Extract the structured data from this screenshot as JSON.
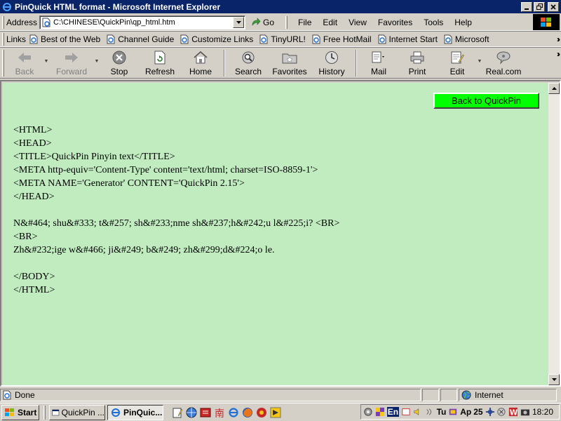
{
  "window": {
    "title": "PinQuick HTML format - Microsoft Internet Explorer",
    "buttons": [
      "minimize-button",
      "restore-button",
      "close-button"
    ]
  },
  "address_bar": {
    "label": "Address",
    "value": "C:\\CHINESE\\QuickPin\\qp_html.htm",
    "go_label": "Go"
  },
  "menu": {
    "items": [
      "File",
      "Edit",
      "View",
      "Favorites",
      "Tools",
      "Help"
    ]
  },
  "links_bar": {
    "label": "Links",
    "items": [
      "Best of the Web",
      "Channel Guide",
      "Customize Links",
      "TinyURL!",
      "Free HotMail",
      "Internet Start",
      "Microsoft"
    ]
  },
  "toolbar": {
    "back": "Back",
    "forward": "Forward",
    "stop": "Stop",
    "refresh": "Refresh",
    "home": "Home",
    "search": "Search",
    "favorites": "Favorites",
    "history": "History",
    "mail": "Mail",
    "print": "Print",
    "edit": "Edit",
    "real": "Real.com"
  },
  "page": {
    "background": "#c0ecc0",
    "back_button_label": "Back to QuickPin",
    "back_button_color": "#00ff00",
    "source_lines": [
      "<HTML>",
      "<HEAD>",
      "<TITLE>QuickPin Pinyin text</TITLE>",
      "<META http-equiv='Content-Type' content='text/html; charset=ISO-8859-1'>",
      "<META NAME='Generator' CONTENT='QuickPin 2.15'>",
      "</HEAD>",
      "",
      "N&#464; shu&#333; t&#257; sh&#233;nme sh&#237;h&#242;u l&#225;i? <BR>",
      "<BR>",
      "Zh&#232;ige w&#466; ji&#249; b&#249; zh&#299;d&#224;o le.",
      "",
      "</BODY>",
      "</HTML>"
    ]
  },
  "status": {
    "text": "Done",
    "zone": "Internet"
  },
  "taskbar": {
    "start": "Start",
    "tasks": [
      "QuickPin ...",
      "PinQuic..."
    ],
    "tray_text_1": "En",
    "tray_text_2": "Tu",
    "tray_text_3": "Ap",
    "tray_text_4": "25",
    "clock": "18:20"
  }
}
